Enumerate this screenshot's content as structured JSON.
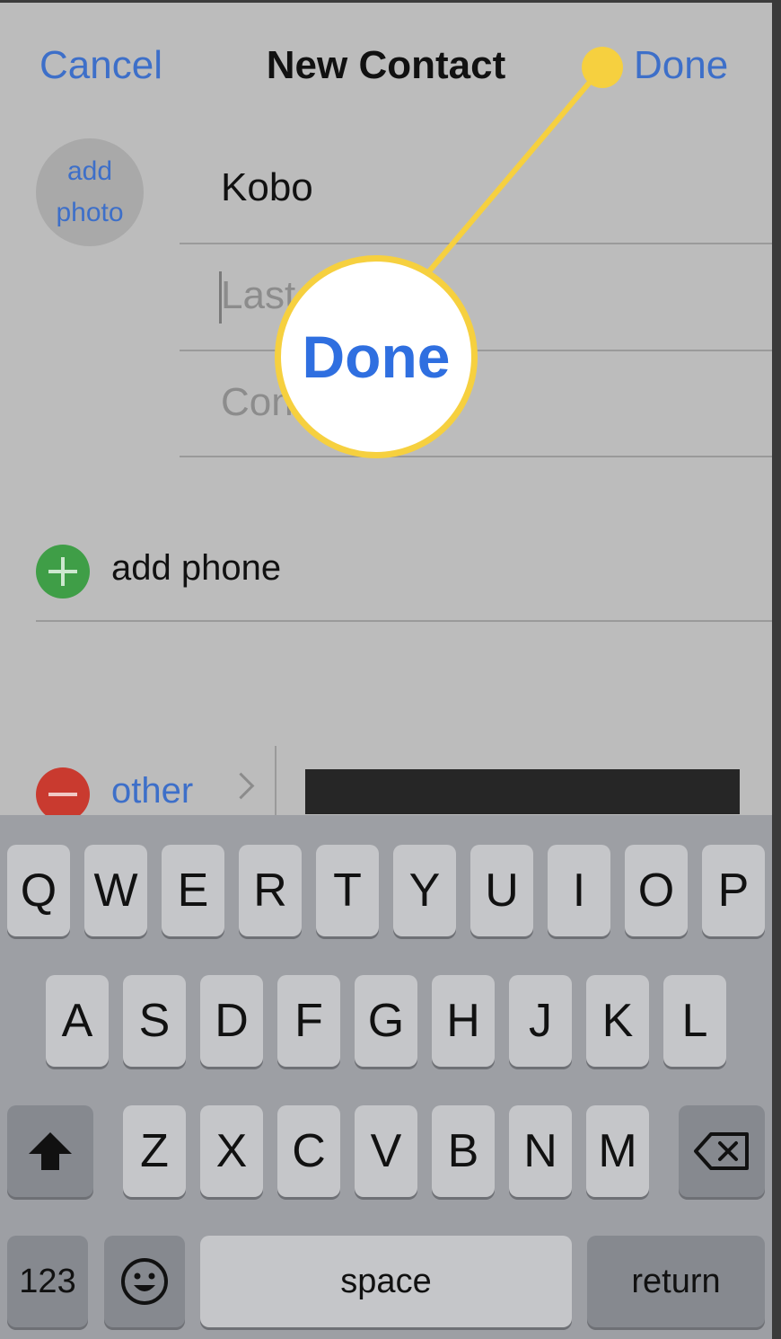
{
  "nav": {
    "cancel": "Cancel",
    "title": "New Contact",
    "done": "Done"
  },
  "photo": {
    "line1": "add",
    "line2": "photo"
  },
  "fields": {
    "first_value": "Kobo",
    "last_visible": "Last",
    "company_visible": "Con"
  },
  "phone": {
    "add_label": "add phone"
  },
  "address": {
    "type_label": "other"
  },
  "callout": {
    "label": "Done"
  },
  "keyboard": {
    "row1": [
      "Q",
      "W",
      "E",
      "R",
      "T",
      "Y",
      "U",
      "I",
      "O",
      "P"
    ],
    "row2": [
      "A",
      "S",
      "D",
      "F",
      "G",
      "H",
      "J",
      "K",
      "L"
    ],
    "row3": [
      "Z",
      "X",
      "C",
      "V",
      "B",
      "N",
      "M"
    ],
    "numbers": "123",
    "space": "space",
    "return": "return"
  },
  "icons": {
    "shift": "shift-icon",
    "delete": "backspace-icon",
    "emoji": "emoji-icon"
  },
  "colors": {
    "accent_blue": "#3d6fc9",
    "callout_yellow": "#f6d03f",
    "add_green": "#3f9e47",
    "remove_red": "#c93a2f"
  }
}
